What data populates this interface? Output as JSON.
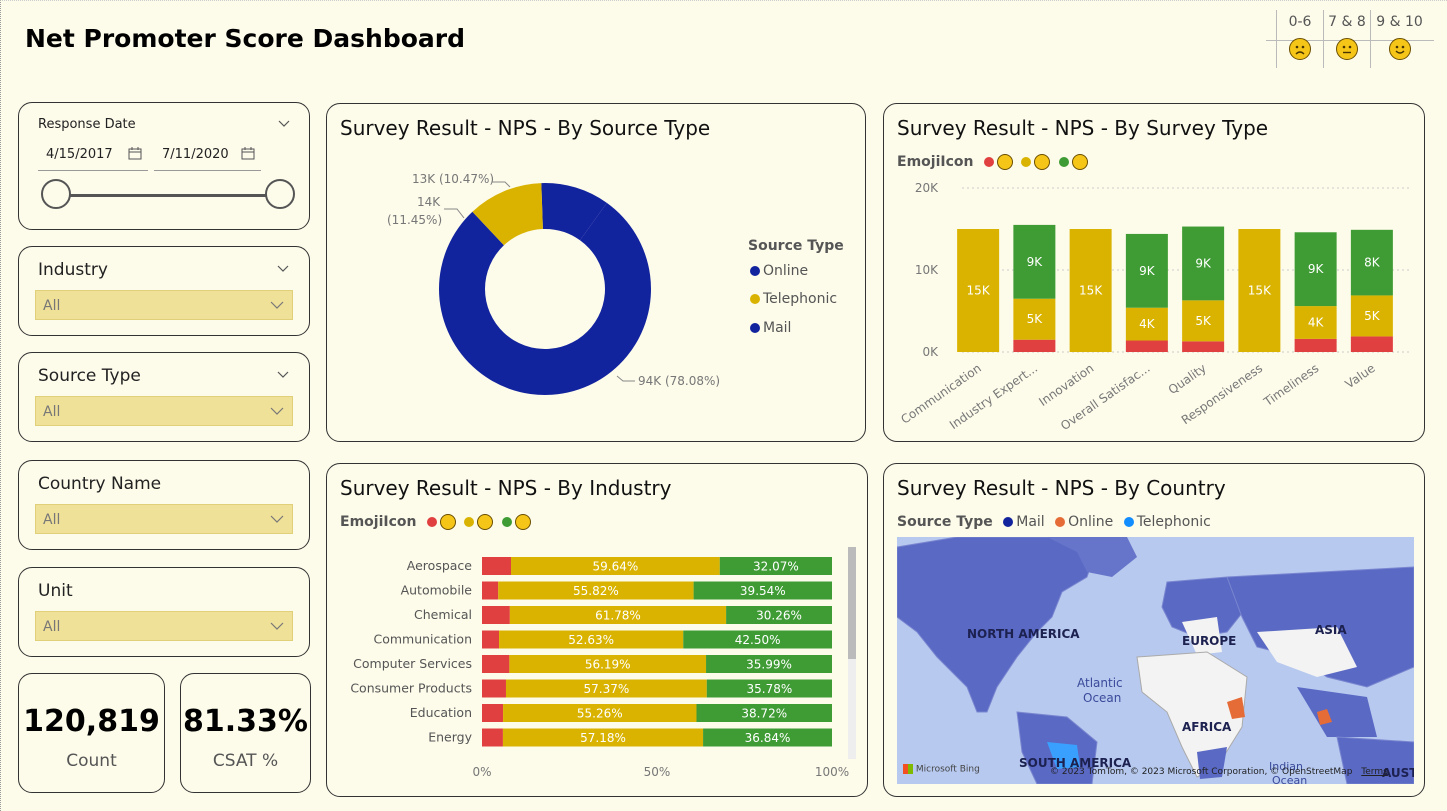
{
  "title": "Net Promoter Score Dashboard",
  "emoji_legend": [
    {
      "label": "0-6",
      "icon": "sad-face-icon"
    },
    {
      "label": "7 & 8",
      "icon": "neutral-face-icon"
    },
    {
      "label": "9 & 10",
      "icon": "happy-face-icon"
    }
  ],
  "response_date": {
    "label": "Response Date",
    "start": "4/15/2017",
    "end": "7/11/2020"
  },
  "slicers": {
    "industry": {
      "label": "Industry",
      "value": "All"
    },
    "source_type": {
      "label": "Source Type",
      "value": "All"
    },
    "country": {
      "label": "Country Name",
      "value": "All"
    },
    "unit": {
      "label": "Unit",
      "value": "All"
    }
  },
  "kpis": {
    "count": {
      "value": "120,819",
      "label": "Count"
    },
    "csat": {
      "value": "81.33%",
      "label": "CSAT %"
    }
  },
  "colors": {
    "mail": "#12239e",
    "telephonic": "#d9b300",
    "online_map": "#e66c37",
    "telephonic_map": "#118dff",
    "red": "#e04040",
    "yellow": "#d9b300",
    "green": "#3f9c35"
  },
  "source_chart": {
    "title": "Survey Result - NPS - By Source Type",
    "legend_title": "Source Type",
    "legend": [
      "Online",
      "Telephonic",
      "Mail"
    ],
    "labels": {
      "small": "13K (10.47%)",
      "mid_1": "14K",
      "mid_2": "(11.45%)",
      "big": "94K (78.08%)"
    }
  },
  "survey_chart": {
    "title": "Survey Result - NPS - By Survey Type",
    "legend_title": "EmojiIcon",
    "y_ticks": [
      "20K",
      "10K",
      "0K"
    ]
  },
  "industry_chart": {
    "title": "Survey Result - NPS - By Industry",
    "legend_title": "EmojiIcon",
    "x_ticks": [
      "0%",
      "50%",
      "100%"
    ]
  },
  "country_chart": {
    "title": "Survey Result - NPS - By Country",
    "legend_title": "Source Type",
    "legend": [
      "Mail",
      "Online",
      "Telephonic"
    ],
    "regions": [
      "NORTH AMERICA",
      "EUROPE",
      "ASIA",
      "AFRICA",
      "SOUTH AMERICA",
      "AUSTRA",
      "Atlantic",
      "Ocean",
      "Indian",
      "Ocean"
    ],
    "attribution": "© 2023 TomTom, © 2023 Microsoft Corporation, © OpenStreetMap",
    "terms": "Terms",
    "bing": "Microsoft Bing"
  },
  "chart_data": [
    {
      "type": "pie",
      "title": "Survey Result - NPS - By Source Type",
      "categories": [
        "Mail",
        "Telephonic",
        "Online"
      ],
      "values": [
        94,
        14,
        13
      ],
      "percent": [
        78.08,
        11.45,
        10.47
      ],
      "unit": "K",
      "donut": true
    },
    {
      "type": "bar",
      "stacked": true,
      "title": "Survey Result - NPS - By Survey Type",
      "categories": [
        "Communication",
        "Industry Expert...",
        "Innovation",
        "Overall Satisfac...",
        "Quality",
        "Responsiveness",
        "Timeliness",
        "Value"
      ],
      "ylim": [
        0,
        20000
      ],
      "series": [
        {
          "name": "0-6",
          "color": "#e04040",
          "values": [
            0,
            1500,
            0,
            1400,
            1300,
            0,
            1600,
            1900
          ]
        },
        {
          "name": "7 & 8",
          "color": "#d9b300",
          "values": [
            15000,
            5000,
            15000,
            4000,
            5000,
            15000,
            4000,
            5000
          ],
          "labels": [
            "15K",
            "5K",
            "15K",
            "4K",
            "5K",
            "15K",
            "4K",
            "5K"
          ]
        },
        {
          "name": "9 & 10",
          "color": "#3f9c35",
          "values": [
            0,
            9000,
            0,
            9000,
            9000,
            0,
            9000,
            8000
          ],
          "labels": [
            "",
            "9K",
            "",
            "9K",
            "9K",
            "",
            "9K",
            "8K"
          ]
        }
      ]
    },
    {
      "type": "bar",
      "orientation": "horizontal",
      "stacked": true,
      "percent": true,
      "title": "Survey Result - NPS - By Industry",
      "categories": [
        "Aerospace",
        "Automobile",
        "Chemical",
        "Communication",
        "Computer Services",
        "Consumer Products",
        "Education",
        "Energy"
      ],
      "series": [
        {
          "name": "0-6",
          "color": "#e04040",
          "values": [
            8.29,
            4.64,
            7.96,
            4.87,
            7.82,
            6.85,
            6.02,
            5.98
          ]
        },
        {
          "name": "7 & 8",
          "color": "#d9b300",
          "values": [
            59.64,
            55.82,
            61.78,
            52.63,
            56.19,
            57.37,
            55.26,
            57.18
          ],
          "labels": [
            "59.64%",
            "55.82%",
            "61.78%",
            "52.63%",
            "56.19%",
            "57.37%",
            "55.26%",
            "57.18%"
          ]
        },
        {
          "name": "9 & 10",
          "color": "#3f9c35",
          "values": [
            32.07,
            39.54,
            30.26,
            42.5,
            35.99,
            35.78,
            38.72,
            36.84
          ],
          "labels": [
            "32.07%",
            "39.54%",
            "30.26%",
            "42.50%",
            "35.99%",
            "35.78%",
            "38.72%",
            "36.84%"
          ]
        }
      ]
    }
  ]
}
